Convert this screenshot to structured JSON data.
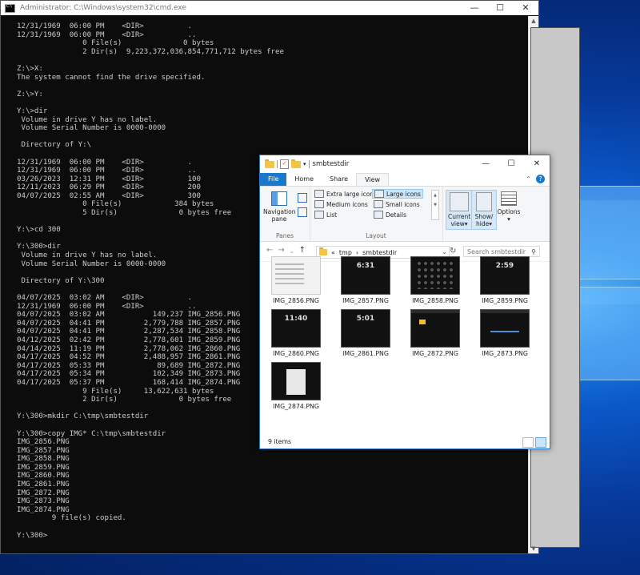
{
  "cmd": {
    "title": "Administrator: C:\\Windows\\system32\\cmd.exe",
    "lines": [
      "12/31/1969  06:00 PM    <DIR>          .",
      "12/31/1969  06:00 PM    <DIR>          ..",
      "               0 File(s)              0 bytes",
      "               2 Dir(s)  9,223,372,036,854,771,712 bytes free",
      "",
      "Z:\\>X:",
      "The system cannot find the drive specified.",
      "",
      "Z:\\>Y:",
      "",
      "Y:\\>dir",
      " Volume in drive Y has no label.",
      " Volume Serial Number is 0000-0000",
      "",
      " Directory of Y:\\",
      "",
      "12/31/1969  06:00 PM    <DIR>          .",
      "12/31/1969  06:00 PM    <DIR>          ..",
      "03/26/2023  12:31 PM    <DIR>          100",
      "12/11/2023  06:29 PM    <DIR>          200",
      "04/07/2025  02:55 AM    <DIR>          300",
      "               0 File(s)            384 bytes",
      "               5 Dir(s)              0 bytes free",
      "",
      "Y:\\>cd 300",
      "",
      "Y:\\300>dir",
      " Volume in drive Y has no label.",
      " Volume Serial Number is 0000-0000",
      "",
      " Directory of Y:\\300",
      "",
      "04/07/2025  03:02 AM    <DIR>          .",
      "12/31/1969  06:00 PM    <DIR>          ..",
      "04/07/2025  03:02 AM           149,237 IMG_2856.PNG",
      "04/07/2025  04:41 PM         2,779,788 IMG_2857.PNG",
      "04/07/2025  04:41 PM         2,287,534 IMG_2858.PNG",
      "04/12/2025  02:42 PM         2,778,601 IMG_2859.PNG",
      "04/14/2025  11:19 PM         2,778,062 IMG_2860.PNG",
      "04/17/2025  04:52 PM         2,488,957 IMG_2861.PNG",
      "04/17/2025  05:33 PM            89,689 IMG_2872.PNG",
      "04/17/2025  05:34 PM           102,349 IMG_2873.PNG",
      "04/17/2025  05:37 PM           168,414 IMG_2874.PNG",
      "               9 File(s)     13,622,631 bytes",
      "               2 Dir(s)              0 bytes free",
      "",
      "Y:\\300>mkdir C:\\tmp\\smbtestdir",
      "",
      "Y:\\300>copy IMG* C:\\tmp\\smbtestdir",
      "IMG_2856.PNG",
      "IMG_2857.PNG",
      "IMG_2858.PNG",
      "IMG_2859.PNG",
      "IMG_2860.PNG",
      "IMG_2861.PNG",
      "IMG_2872.PNG",
      "IMG_2873.PNG",
      "IMG_2874.PNG",
      "        9 file(s) copied.",
      "",
      "Y:\\300>"
    ]
  },
  "explorer": {
    "title": "smbtestdir",
    "tabs": [
      "File",
      "Home",
      "Share",
      "View"
    ],
    "panes": {
      "nav_pane": "Navigation pane",
      "group": "Panes"
    },
    "layout": {
      "items": [
        "Extra large icons",
        "Large icons",
        "Medium icons",
        "Small icons",
        "List",
        "Details"
      ],
      "selected": "Large icons",
      "group": "Layout"
    },
    "current_view": "Current view",
    "show_hide": "Show/ hide",
    "options": "Options",
    "address": {
      "prefix": "«",
      "parts": [
        "tmp",
        "smbtestdir"
      ]
    },
    "search_placeholder": "Search smbtestdir",
    "files": [
      {
        "name": "IMG_2856.PNG",
        "thumb": "light"
      },
      {
        "name": "IMG_2857.PNG",
        "thumb": "clock",
        "clock": "6:31"
      },
      {
        "name": "IMG_2858.PNG",
        "thumb": "grid"
      },
      {
        "name": "IMG_2859.PNG",
        "thumb": "clock",
        "clock": "2:59"
      },
      {
        "name": "IMG_2860.PNG",
        "thumb": "clock",
        "clock": "11:40"
      },
      {
        "name": "IMG_2861.PNG",
        "thumb": "clock",
        "clock": "5:01"
      },
      {
        "name": "IMG_2872.PNG",
        "thumb": "folder"
      },
      {
        "name": "IMG_2873.PNG",
        "thumb": "progress"
      },
      {
        "name": "IMG_2874.PNG",
        "thumb": "dialog"
      }
    ],
    "status": "9 items"
  }
}
